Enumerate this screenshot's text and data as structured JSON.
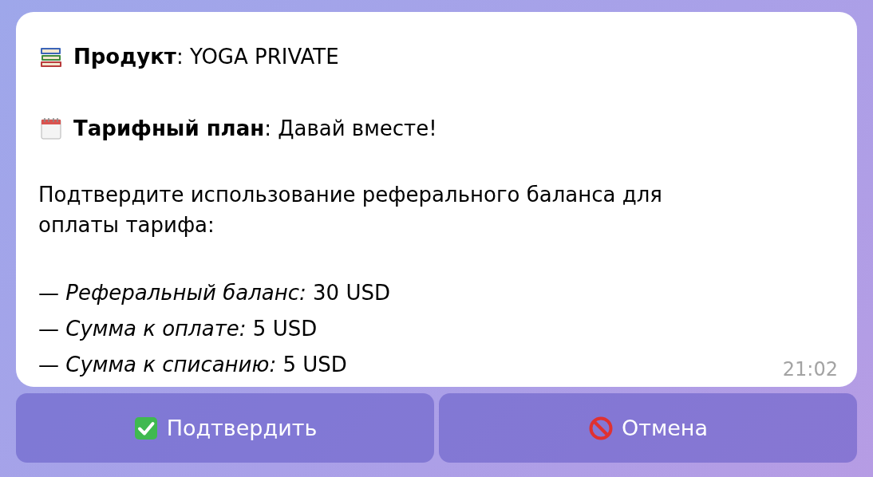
{
  "message": {
    "header_lines": [
      "**Продукт**: YOGA PRIVATE",
      "**Тарифный план**: Давай вместе!"
    ],
    "prompt": "Подтвердите использование реферального баланса для оплаты тарифа:",
    "details": [
      "— *Реферальный баланс:* 30 USD",
      "— *Сумма к оплате:* 5 USD",
      "— *Сумма к списанию:* 5 USD"
    ],
    "time": "21:02"
  },
  "buttons": [
    {
      "label": "Подтвердить"
    },
    {
      "label": "Отмена"
    }
  ]
}
